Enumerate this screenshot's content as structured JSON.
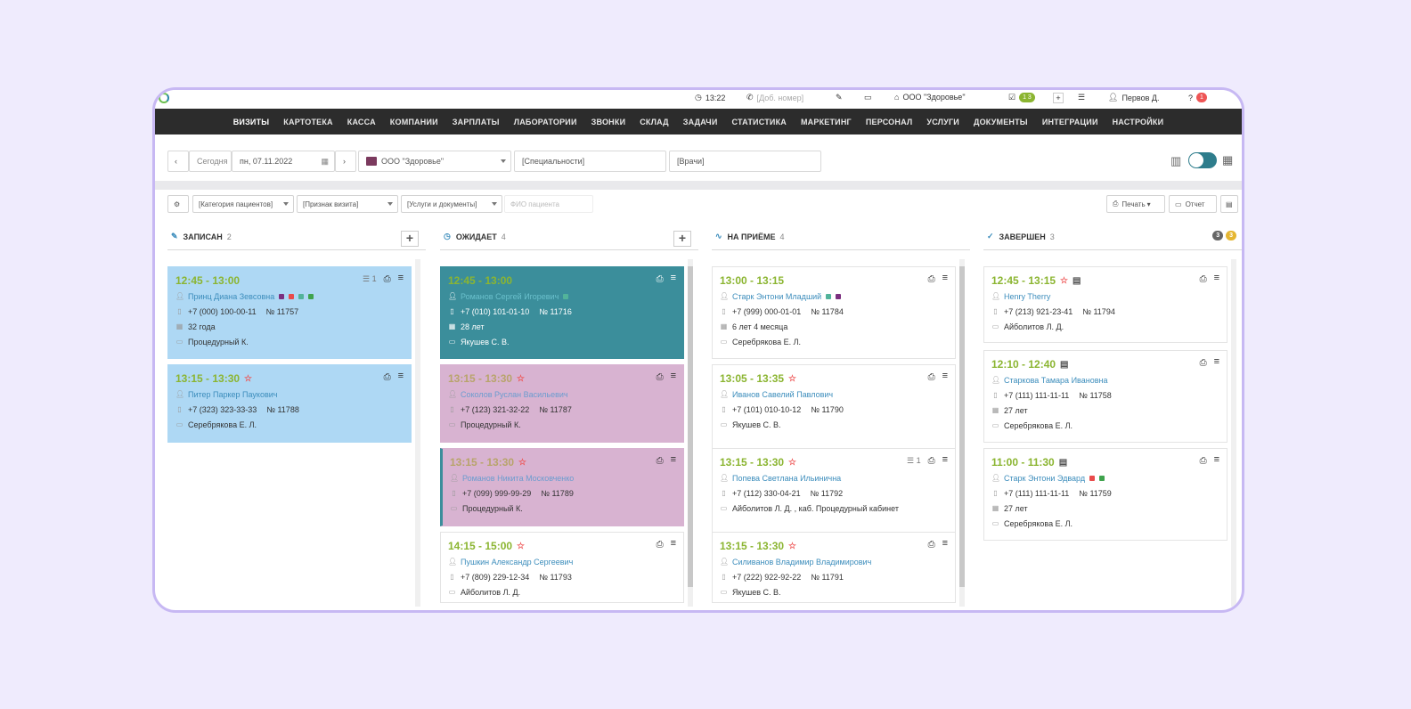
{
  "topbar": {
    "time": "13:22",
    "phone_placeholder": "Доб. номер",
    "org": "ООО \"Здоровье\"",
    "tasks_badge": "1 3",
    "user": "Первов Д.",
    "help_badge": "1"
  },
  "nav": [
    "ВИЗИТЫ",
    "КАРТОТЕКА",
    "КАССА",
    "КОМПАНИИ",
    "ЗАРПЛАТЫ",
    "ЛАБОРАТОРИИ",
    "ЗВОНКИ",
    "СКЛАД",
    "ЗАДАЧИ",
    "СТАТИСТИКА",
    "МАРКЕТИНГ",
    "ПЕРСОНАЛ",
    "УСЛУГИ",
    "ДОКУМЕНТЫ",
    "ИНТЕГРАЦИИ",
    "НАСТРОЙКИ"
  ],
  "filters": {
    "today": "Сегодня",
    "date": "пн, 07.11.2022",
    "org": "ООО \"Здоровье\"",
    "org_color": "#7b3a5e",
    "specialty": "[Специальности]",
    "doctors": "[Врачи]"
  },
  "tools": {
    "patient_category": "[Категория пациентов]",
    "visit_sign": "[Признак визита]",
    "services": "[Услуги и документы]",
    "fio_placeholder": "ФИО пациента",
    "print": "Печать",
    "report": "Отчет"
  },
  "columns": [
    {
      "title": "ЗАПИСАН",
      "count": "2",
      "cards": [
        {
          "time": "12:45 - 13:00",
          "name": "Принц Диана Зевсовна",
          "phone": "+7 (000) 100-00-11",
          "num": "№ 11757",
          "age": "32 года",
          "room": "Процедурный К.",
          "list_count": "1"
        },
        {
          "time": "13:15 - 13:30",
          "name": "Питер Паркер Паукович",
          "phone": "+7 (323) 323-33-33",
          "num": "№ 11788",
          "doctor": "Серебрякова Е. Л."
        }
      ]
    },
    {
      "title": "ОЖИДАЕТ",
      "count": "4",
      "cards": [
        {
          "time": "12:45 - 13:00",
          "name": "Романов Сергей Игоревич",
          "phone": "+7 (010) 101-01-10",
          "num": "№ 11716",
          "age": "28 лет",
          "doctor": "Якушев С. В."
        },
        {
          "time": "13:15 - 13:30",
          "name": "Соколов Руслан Васильевич",
          "phone": "+7 (123) 321-32-22",
          "num": "№ 11787",
          "room": "Процедурный К."
        },
        {
          "time": "13:15 - 13:30",
          "name": "Романов Никита Московченко",
          "phone": "+7 (099) 999-99-29",
          "num": "№ 11789",
          "room": "Процедурный К."
        },
        {
          "time": "14:15 - 15:00",
          "name": "Пушкин Александр Сергеевич",
          "phone": "+7 (809) 229-12-34",
          "num": "№ 11793",
          "doctor": "Айболитов Л. Д."
        }
      ]
    },
    {
      "title": "НА ПРИЁМЕ",
      "count": "4",
      "cards": [
        {
          "time": "13:00 - 13:15",
          "name": "Старк Энтони Младший",
          "phone": "+7 (999) 000-01-01",
          "num": "№ 11784",
          "age": "6 лет 4 месяца",
          "doctor": "Серебрякова Е. Л."
        },
        {
          "time": "13:05 - 13:35",
          "name": "Иванов Савелий Павлович",
          "phone": "+7 (101) 010-10-12",
          "num": "№ 11790",
          "doctor": "Якушев С. В."
        },
        {
          "time": "13:15 - 13:30",
          "name": "Попева Светлана Ильинична",
          "phone": "+7 (112) 330-04-21",
          "num": "№ 11792",
          "doctor": "Айболитов Л. Д. , каб. Процедурный кабинет",
          "list_count": "1"
        },
        {
          "time": "13:15 - 13:30",
          "name": "Силиванов Владимир Владимирович",
          "phone": "+7 (222) 922-92-22",
          "num": "№ 11791",
          "doctor": "Якушев С. В."
        }
      ]
    },
    {
      "title": "ЗАВЕРШЕН",
      "count": "3",
      "badge1": "3",
      "badge2": "3",
      "cards": [
        {
          "time": "12:45 - 13:15",
          "name": "Henry Therry",
          "phone": "+7 (213) 921-23-41",
          "num": "№ 11794",
          "doctor": "Айболитов Л. Д."
        },
        {
          "time": "12:10 - 12:40",
          "name": "Старкова Тамара Ивановна",
          "phone": "+7 (111) 111-11-11",
          "num": "№ 11758",
          "age": "27 лет",
          "doctor": "Серебрякова Е. Л."
        },
        {
          "time": "11:00 - 11:30",
          "name": "Старк Энтони Эдвард",
          "phone": "+7 (111) 111-11-11",
          "num": "№ 11759",
          "age": "27 лет",
          "doctor": "Серебрякова Е. Л."
        }
      ]
    }
  ]
}
